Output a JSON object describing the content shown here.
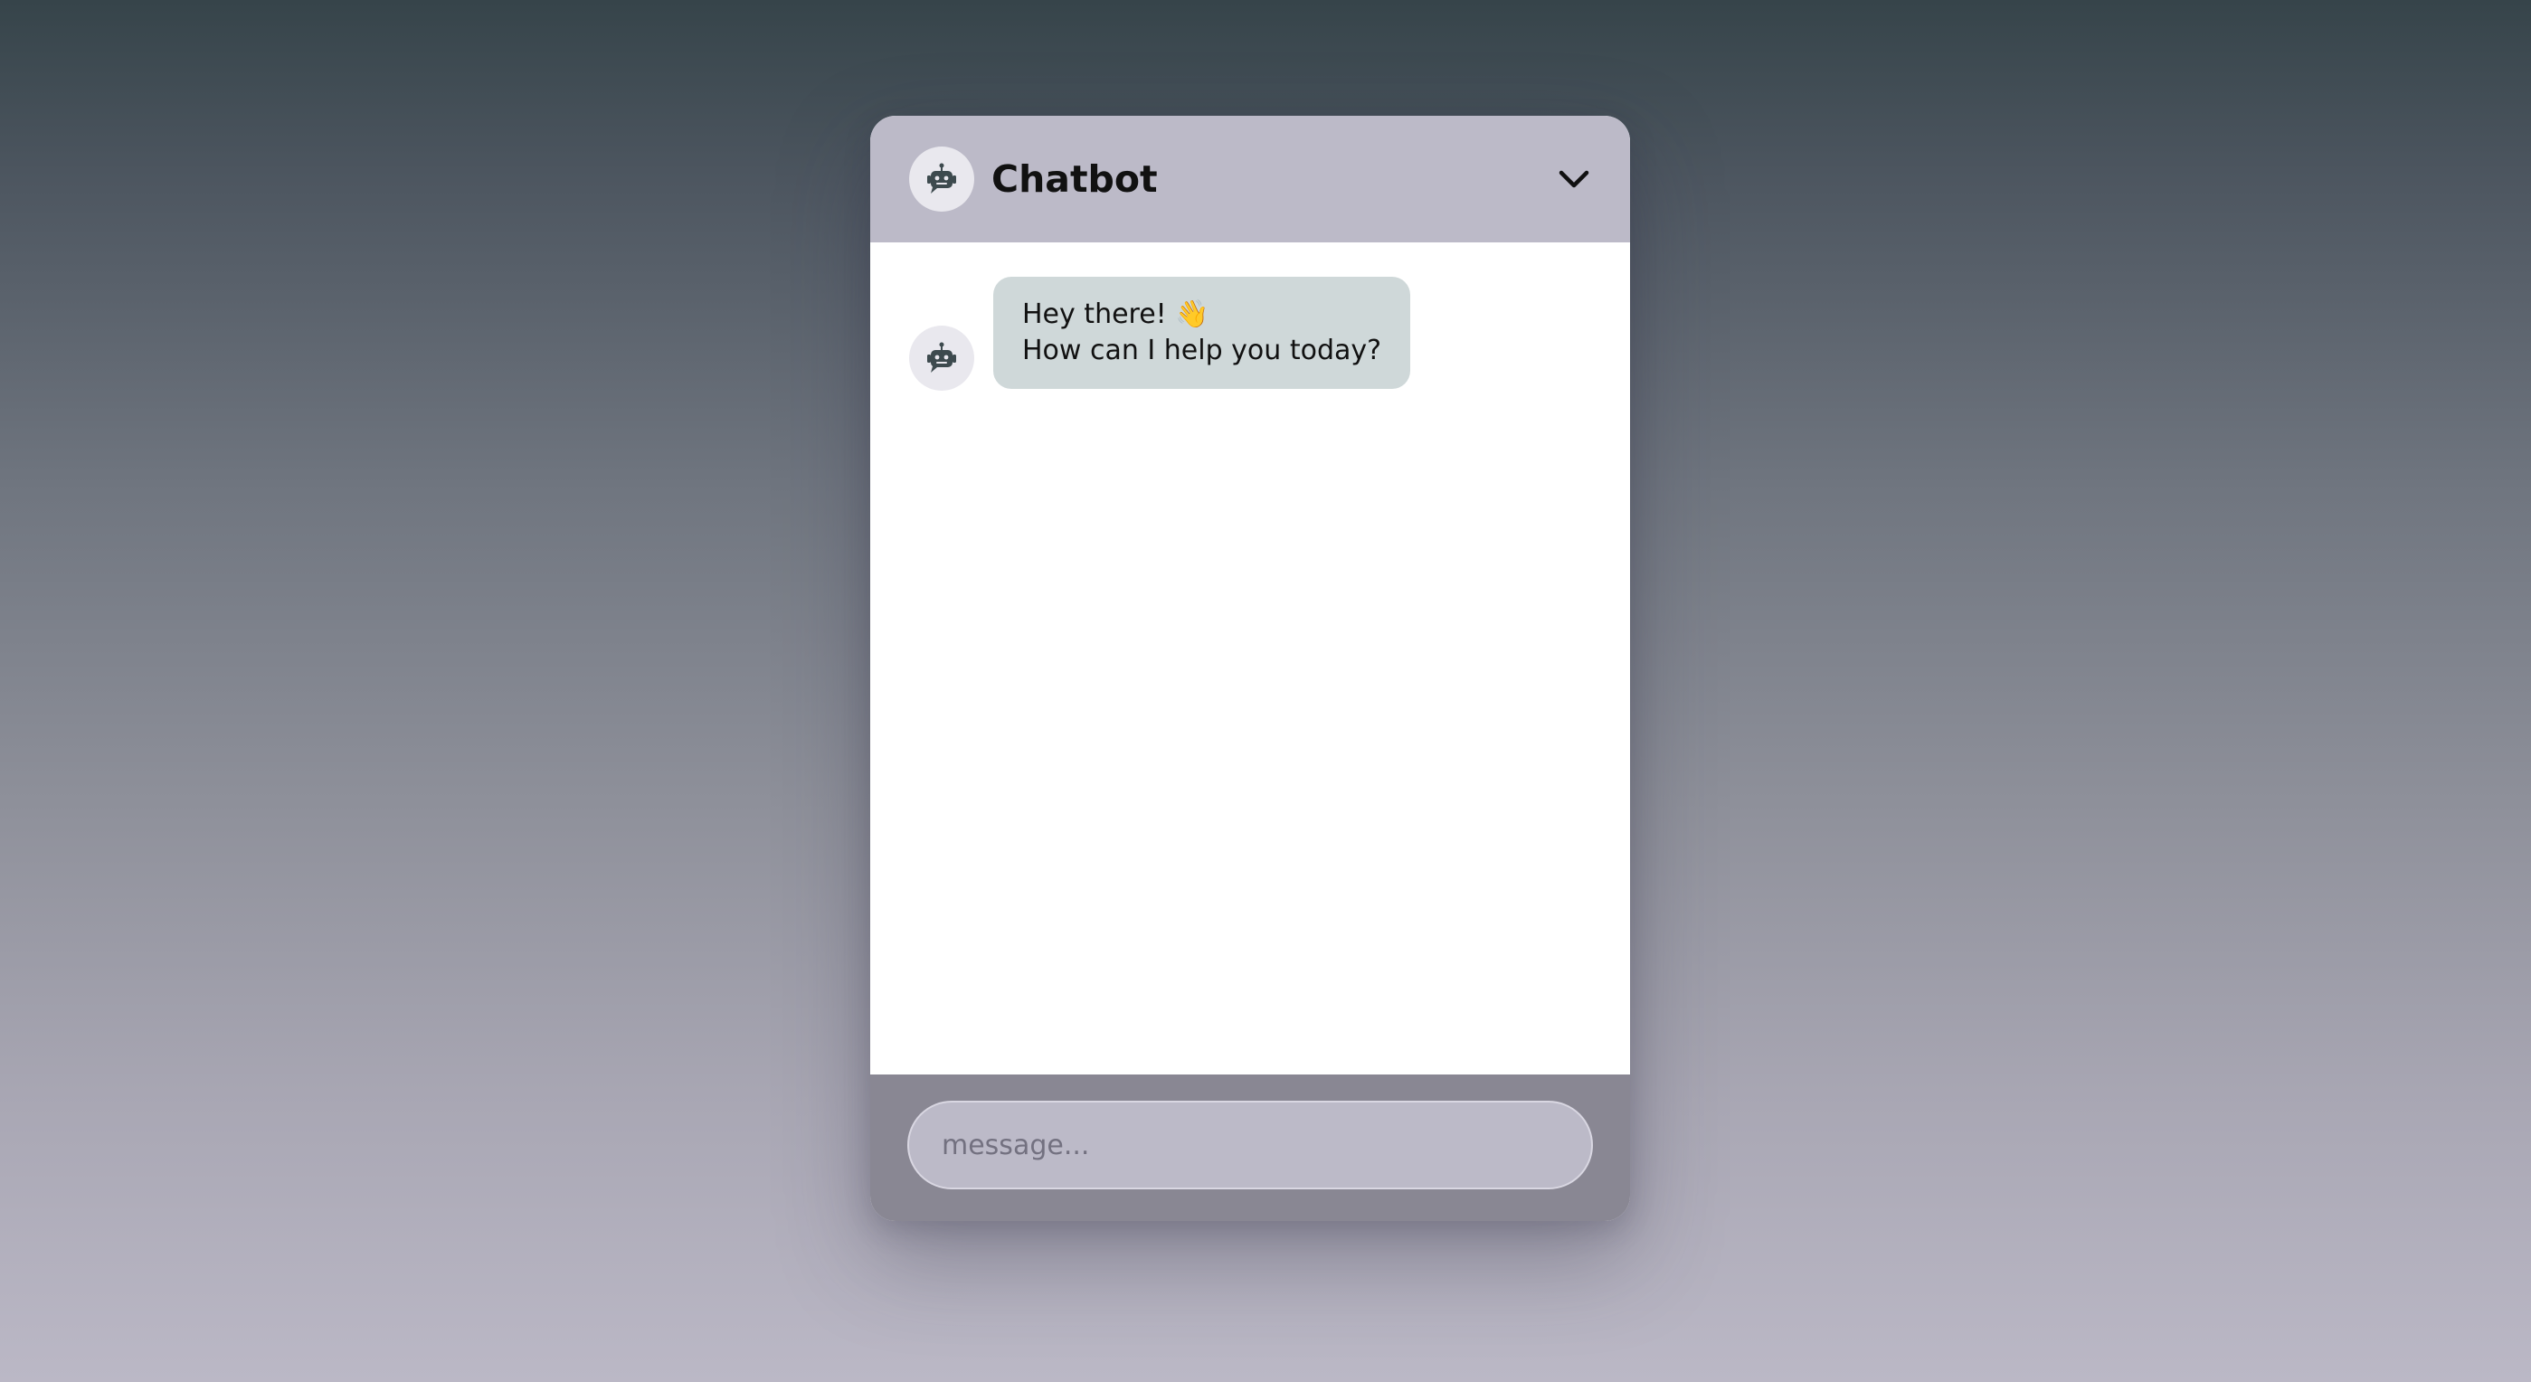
{
  "header": {
    "title": "Chatbot",
    "avatar_icon": "robot-icon",
    "toggle_icon": "chevron-down-icon"
  },
  "messages": [
    {
      "sender": "bot",
      "avatar_icon": "robot-icon",
      "line1": "Hey there! 👋",
      "line2": "How can I help you today?"
    }
  ],
  "footer": {
    "input_placeholder": "message...",
    "input_value": ""
  },
  "colors": {
    "header_bg": "#bcbac8",
    "bubble_bg": "#cfd8d9",
    "footer_bg": "#898793",
    "icon_color": "#3d4a4e"
  }
}
